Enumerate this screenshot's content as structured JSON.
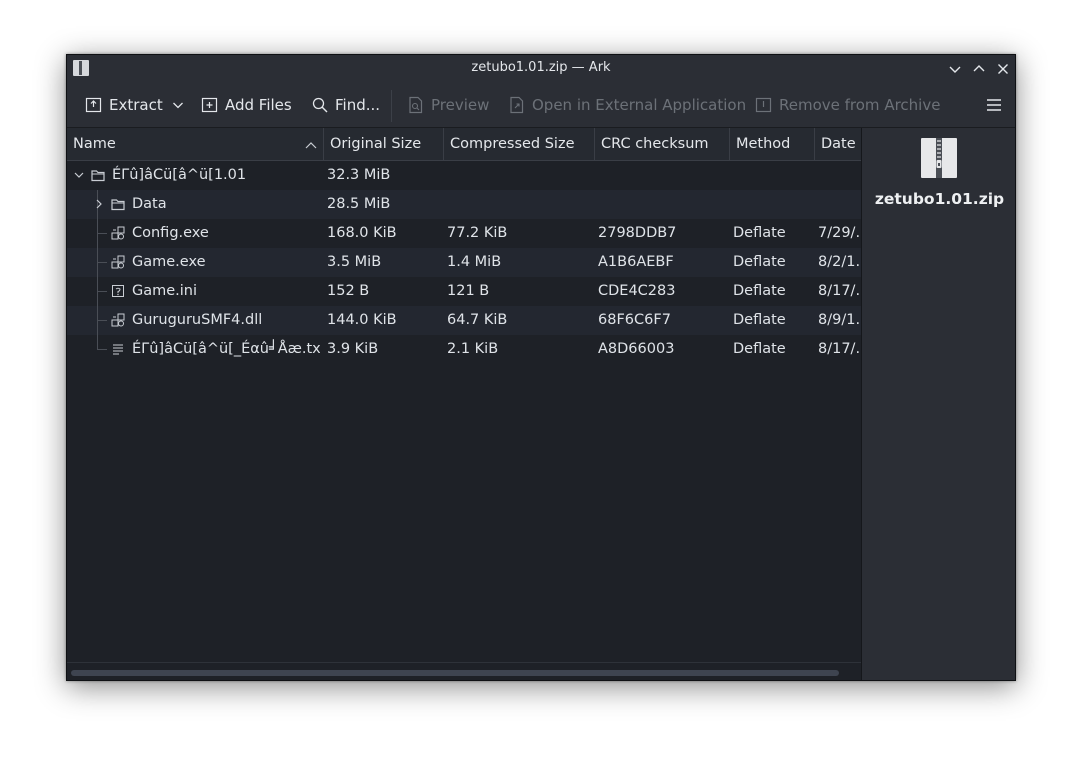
{
  "window": {
    "title": "zetubo1.01.zip — Ark"
  },
  "toolbar": {
    "extract_label": "Extract",
    "add_files_label": "Add Files",
    "find_label": "Find...",
    "preview_label": "Preview",
    "open_external_label": "Open in External Application",
    "remove_label": "Remove from Archive"
  },
  "columns": [
    "Name",
    "Original Size",
    "Compressed Size",
    "CRC checksum",
    "Method",
    "Date"
  ],
  "rows": [
    {
      "name": "ÉΓû]âCü[â^ü[1.01",
      "original_size": "32.3 MiB",
      "compressed_size": "",
      "crc": "",
      "method": "",
      "date": "",
      "type": "folder",
      "level": 0,
      "expanded": true
    },
    {
      "name": "Data",
      "original_size": "28.5 MiB",
      "compressed_size": "",
      "crc": "",
      "method": "",
      "date": "",
      "type": "folder",
      "level": 1,
      "expanded": false
    },
    {
      "name": "Config.exe",
      "original_size": "168.0 KiB",
      "compressed_size": "77.2 KiB",
      "crc": "2798DDB7",
      "method": "Deflate",
      "date": "7/29/.",
      "type": "exe",
      "level": 1
    },
    {
      "name": "Game.exe",
      "original_size": "3.5 MiB",
      "compressed_size": "1.4 MiB",
      "crc": "A1B6AEBF",
      "method": "Deflate",
      "date": "8/2/1.",
      "type": "exe",
      "level": 1
    },
    {
      "name": "Game.ini",
      "original_size": "152 B",
      "compressed_size": "121 B",
      "crc": "CDE4C283",
      "method": "Deflate",
      "date": "8/17/.",
      "type": "ini",
      "level": 1
    },
    {
      "name": "GuruguruSMF4.dll",
      "original_size": "144.0 KiB",
      "compressed_size": "64.7 KiB",
      "crc": "68F6C6F7",
      "method": "Deflate",
      "date": "8/9/1.",
      "type": "exe",
      "level": 1
    },
    {
      "name": "ÉΓû]âCü[â^ü[_Éαû╛Åæ.txt",
      "original_size": "3.9 KiB",
      "compressed_size": "2.1 KiB",
      "crc": "A8D66003",
      "method": "Deflate",
      "date": "8/17/.",
      "type": "txt",
      "level": 1
    }
  ],
  "side_panel": {
    "file_name": "zetubo1.01.zip"
  },
  "icons": {
    "app": "ark-app-icon",
    "folder": "folder-icon",
    "exe": "executable-icon",
    "ini": "config-file-icon",
    "txt": "text-file-icon"
  },
  "colors": {
    "background": "#1e2127",
    "alt_row": "#232730",
    "chrome": "#2b2e35",
    "text": "#dfe3e8",
    "disabled_text": "#6c7178"
  }
}
